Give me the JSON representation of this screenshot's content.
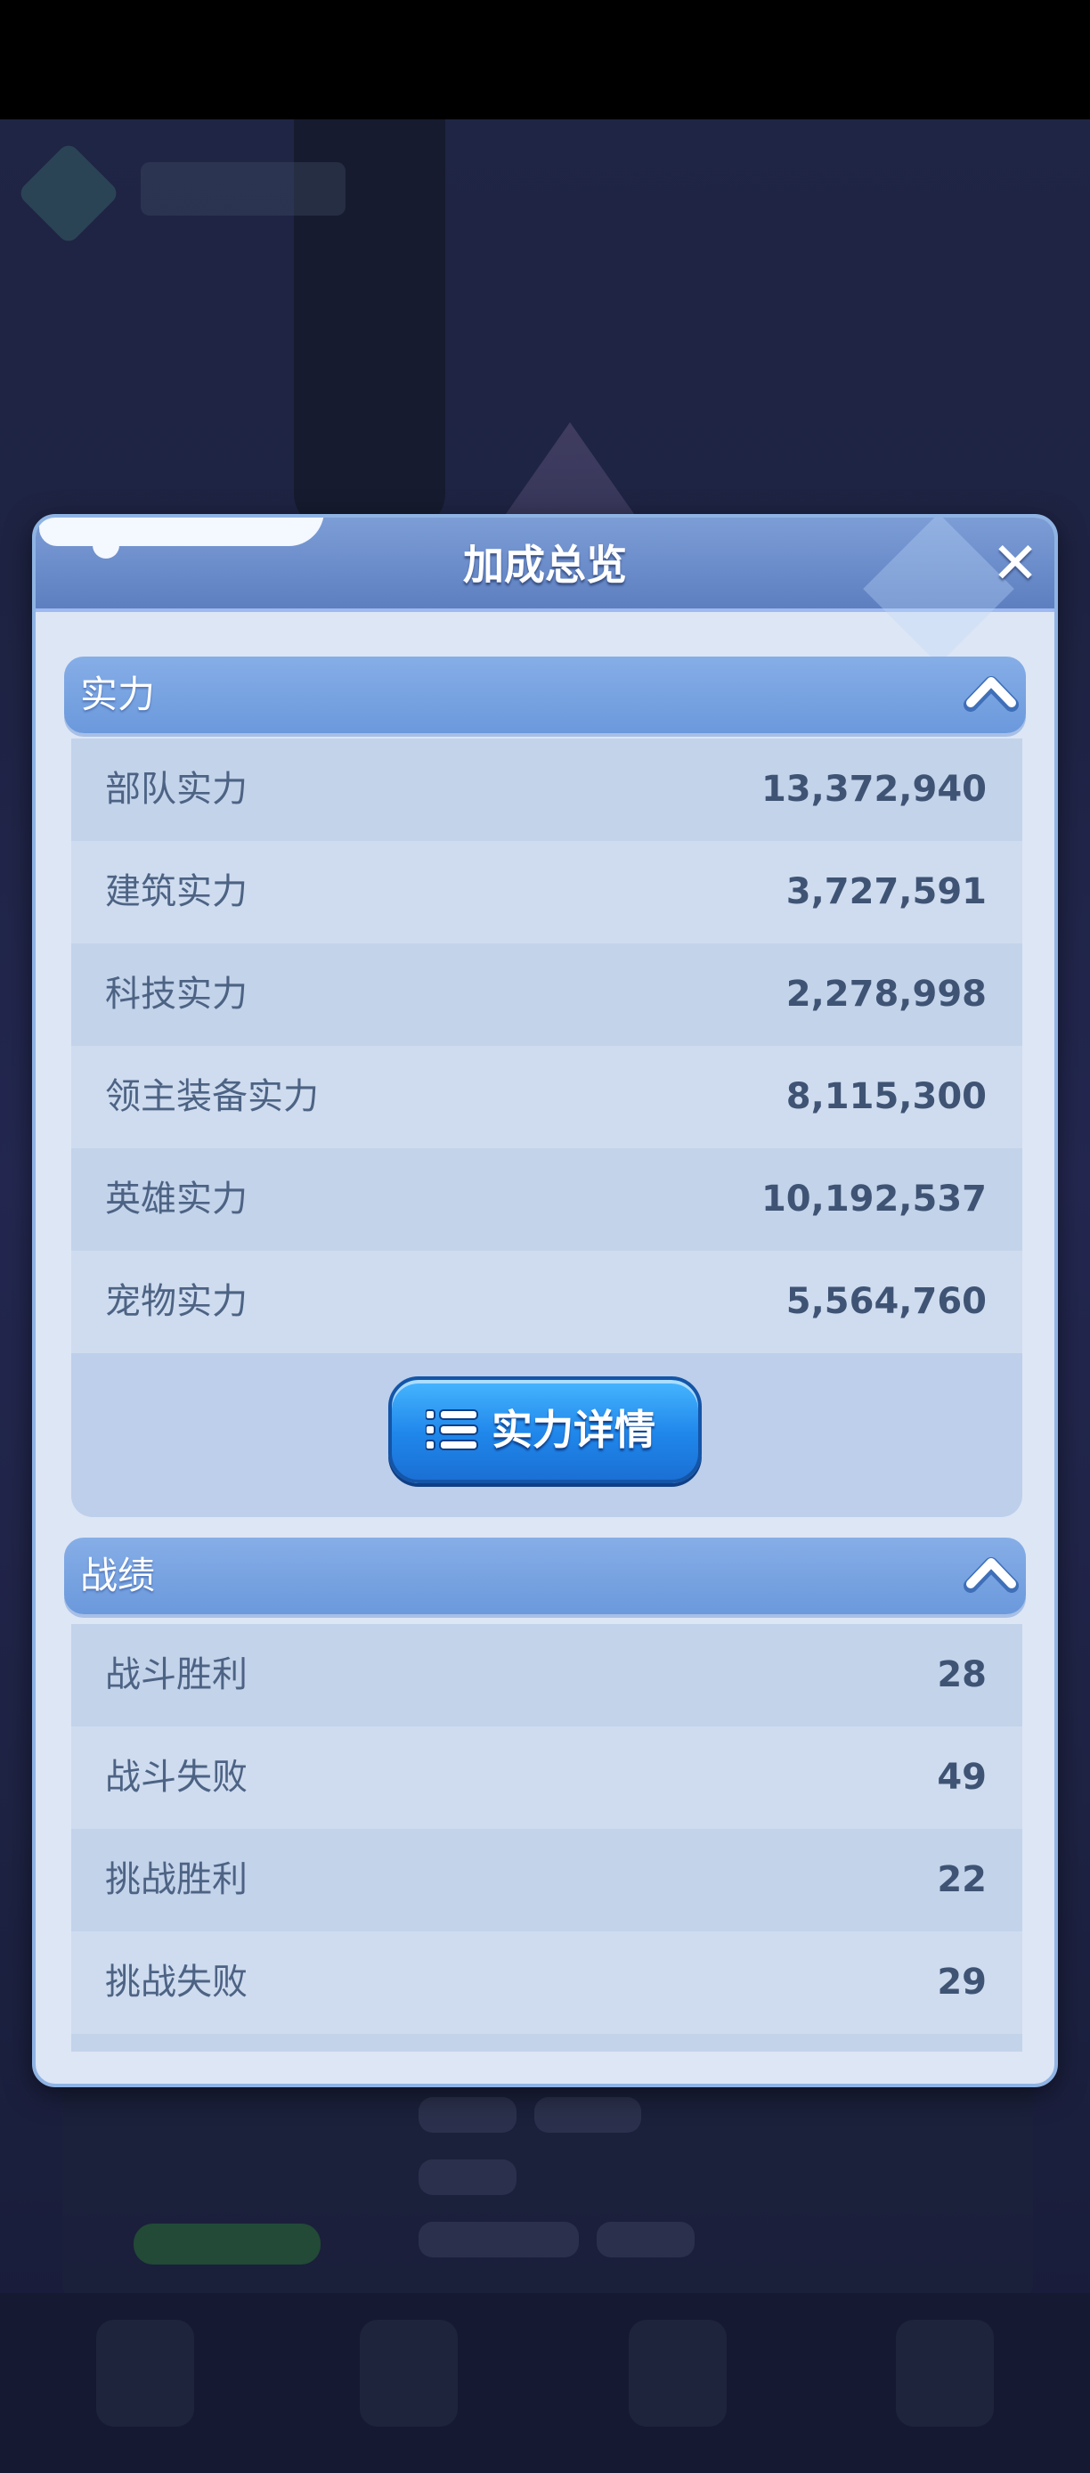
{
  "dialog": {
    "title": "加成总览",
    "close_icon": "close-icon"
  },
  "sections": {
    "power": {
      "title": "实力",
      "toggle_icon": "chevron-up-icon",
      "rows": [
        {
          "label": "部队实力",
          "value": "13,372,940"
        },
        {
          "label": "建筑实力",
          "value": "3,727,591"
        },
        {
          "label": "科技实力",
          "value": "2,278,998"
        },
        {
          "label": "领主装备实力",
          "value": "8,115,300"
        },
        {
          "label": "英雄实力",
          "value": "10,192,537"
        },
        {
          "label": "宠物实力",
          "value": "5,564,760"
        }
      ],
      "detail_button": {
        "label": "实力详情",
        "icon": "list-icon"
      }
    },
    "record": {
      "title": "战绩",
      "toggle_icon": "chevron-up-icon",
      "rows": [
        {
          "label": "战斗胜利",
          "value": "28"
        },
        {
          "label": "战斗失败",
          "value": "49"
        },
        {
          "label": "挑战胜利",
          "value": "22"
        },
        {
          "label": "挑战失败",
          "value": "29"
        }
      ]
    }
  },
  "colors": {
    "header": "#6b8fd0",
    "panel": "#dde6f5",
    "section_head": "#76a2e0",
    "button": "#2d8ff0",
    "label_text": "#4d6384"
  }
}
